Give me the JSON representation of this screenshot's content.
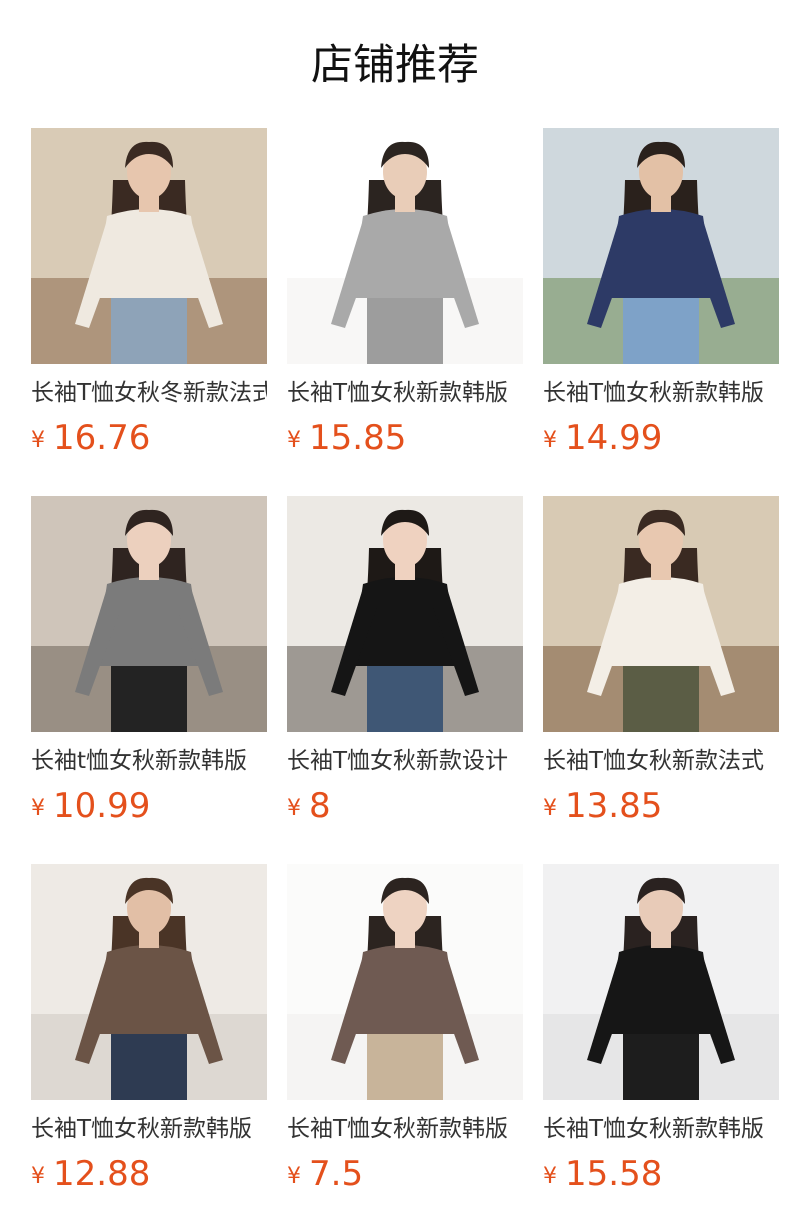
{
  "header": {
    "title": "店铺推荐"
  },
  "products": [
    {
      "name": "长袖T恤女秋冬新款法式",
      "currency": "¥",
      "price": "16.76",
      "image": {
        "shirt": "#efe9e0",
        "bg": "#8a6a4c",
        "bg2": "#d9cbb6",
        "pants": "#8ea3b8",
        "skin": "#e7c6ae",
        "hair": "#3a2a22"
      }
    },
    {
      "name": "长袖T恤女秋新款韩版",
      "currency": "¥",
      "price": "15.85",
      "image": {
        "shirt": "#a9a9a9",
        "bg": "#f2f1ef",
        "bg2": "#ffffff",
        "pants": "#9d9d9d",
        "skin": "#e9cdb8",
        "hair": "#2b2420"
      }
    },
    {
      "name": "长袖T恤女秋新款韩版",
      "currency": "¥",
      "price": "14.99",
      "image": {
        "shirt": "#2d3a66",
        "bg": "#6b8a52",
        "bg2": "#cfd8dd",
        "pants": "#7ea2c8",
        "skin": "#e3c1a6",
        "hair": "#2a211c"
      }
    },
    {
      "name": "长袖t恤女秋新款韩版",
      "currency": "¥",
      "price": "10.99",
      "image": {
        "shirt": "#7b7b7b",
        "bg": "#6e6358",
        "bg2": "#cfc5ba",
        "pants": "#232323",
        "skin": "#ecd0be",
        "hair": "#2f2420"
      }
    },
    {
      "name": "长袖T恤女秋新款设计",
      "currency": "¥",
      "price": "8",
      "image": {
        "shirt": "#151515",
        "bg": "#5e5750",
        "bg2": "#ece9e4",
        "pants": "#3f5775",
        "skin": "#efd2c0",
        "hair": "#1e1916"
      }
    },
    {
      "name": "长袖T恤女秋新款法式",
      "currency": "¥",
      "price": "13.85",
      "image": {
        "shirt": "#f3eee6",
        "bg": "#7a5a3c",
        "bg2": "#d8cab4",
        "pants": "#5b5d45",
        "skin": "#e8c8b0",
        "hair": "#3a2a22"
      }
    },
    {
      "name": "长袖T恤女秋新款韩版",
      "currency": "¥",
      "price": "12.88",
      "image": {
        "shirt": "#6b5446",
        "bg": "#cfc9c2",
        "bg2": "#eeeae5",
        "pants": "#2e3b52",
        "skin": "#e2bfa6",
        "hair": "#4a3426"
      }
    },
    {
      "name": "长袖T恤女秋新款韩版",
      "currency": "¥",
      "price": "7.5",
      "image": {
        "shirt": "#6f5a52",
        "bg": "#f0efec",
        "bg2": "#fbfbfa",
        "pants": "#c8b49a",
        "skin": "#eed3c2",
        "hair": "#2c2420"
      }
    },
    {
      "name": "长袖T恤女秋新款韩版",
      "currency": "¥",
      "price": "15.58",
      "image": {
        "shirt": "#161616",
        "bg": "#dcdcde",
        "bg2": "#f1f1f2",
        "pants": "#1d1d1d",
        "skin": "#e8cbb8",
        "hair": "#2a2220"
      }
    }
  ]
}
